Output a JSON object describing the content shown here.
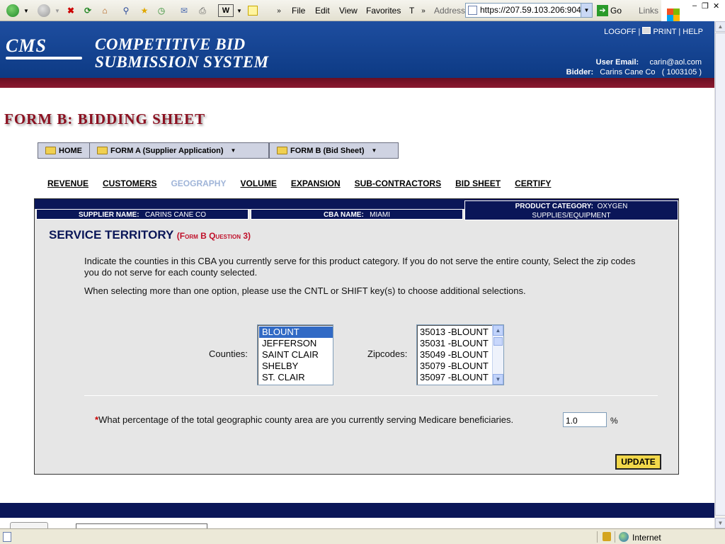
{
  "browser": {
    "menu": [
      "File",
      "Edit",
      "View",
      "Favorites",
      "T"
    ],
    "address_label": "Address",
    "address_url": "https://207.59.103.206:904",
    "go_label": "Go",
    "links_label": "Links"
  },
  "header": {
    "logo": "CMS",
    "title_line1": "COMPETITIVE BID",
    "title_line2": "SUBMISSION SYSTEM",
    "links": {
      "logoff": "LOGOFF",
      "sep1": "|",
      "print": "PRINT",
      "sep2": "|",
      "help": "HELP"
    },
    "user_email_label": "User Email:",
    "user_email": "carin@aol.com",
    "bidder_label": "Bidder:",
    "bidder_name": "Carins Cane Co",
    "bidder_id": "(    1003105   )"
  },
  "page_title": "FORM B:  BIDDING SHEET",
  "nav": {
    "home": "HOME",
    "form_a": "FORM A (Supplier Application)",
    "form_b": "FORM B (Bid Sheet)"
  },
  "tabs": [
    {
      "label": "REVENUE",
      "active": false
    },
    {
      "label": "CUSTOMERS",
      "active": false
    },
    {
      "label": "GEOGRAPHY",
      "active": true
    },
    {
      "label": "VOLUME",
      "active": false
    },
    {
      "label": "EXPANSION",
      "active": false
    },
    {
      "label": "SUB-CONTRACTORS",
      "active": false
    },
    {
      "label": "BID SHEET",
      "active": false
    },
    {
      "label": "CERTIFY",
      "active": false
    }
  ],
  "info": {
    "supplier_label": "SUPPLIER NAME:",
    "supplier_value": "CARINS CANE CO",
    "cba_label": "CBA NAME:",
    "cba_value": "MIAMI",
    "product_label": "PRODUCT CATEGORY:",
    "product_value_1": "OXYGEN",
    "product_value_2": "SUPPLIES/EQUIPMENT"
  },
  "section": {
    "title": "SERVICE TERRITORY",
    "subtitle": "(Form B Question 3)",
    "desc1": "Indicate the counties in this CBA you currently serve for this product category. If you do not serve the entire county, Select the zip codes you do not serve for each county selected.",
    "desc2": "When selecting more than one option, please use the CNTL or SHIFT key(s) to choose additional selections."
  },
  "counties": {
    "label": "Counties:",
    "options": [
      "BLOUNT",
      "JEFFERSON",
      "SAINT CLAIR",
      "SHELBY",
      "ST. CLAIR"
    ],
    "selected": "BLOUNT"
  },
  "zipcodes": {
    "label": "Zipcodes:",
    "options": [
      "35013 -BLOUNT",
      "35031 -BLOUNT",
      "35049 -BLOUNT",
      "35079 -BLOUNT",
      "35097 -BLOUNT"
    ]
  },
  "percentage": {
    "required": "*",
    "question": "What percentage of the total geographic county area are you currently serving Medicare beneficiaries.",
    "value": "1.0",
    "unit": "%"
  },
  "update_label": "UPDATE",
  "status": {
    "zone": "Internet"
  },
  "colors": {
    "header_blue": "#0d3a84",
    "navy": "#0a1658",
    "maroon": "#8b1020",
    "update_yellow": "#f2d84a",
    "selection_blue": "#316ac5"
  }
}
